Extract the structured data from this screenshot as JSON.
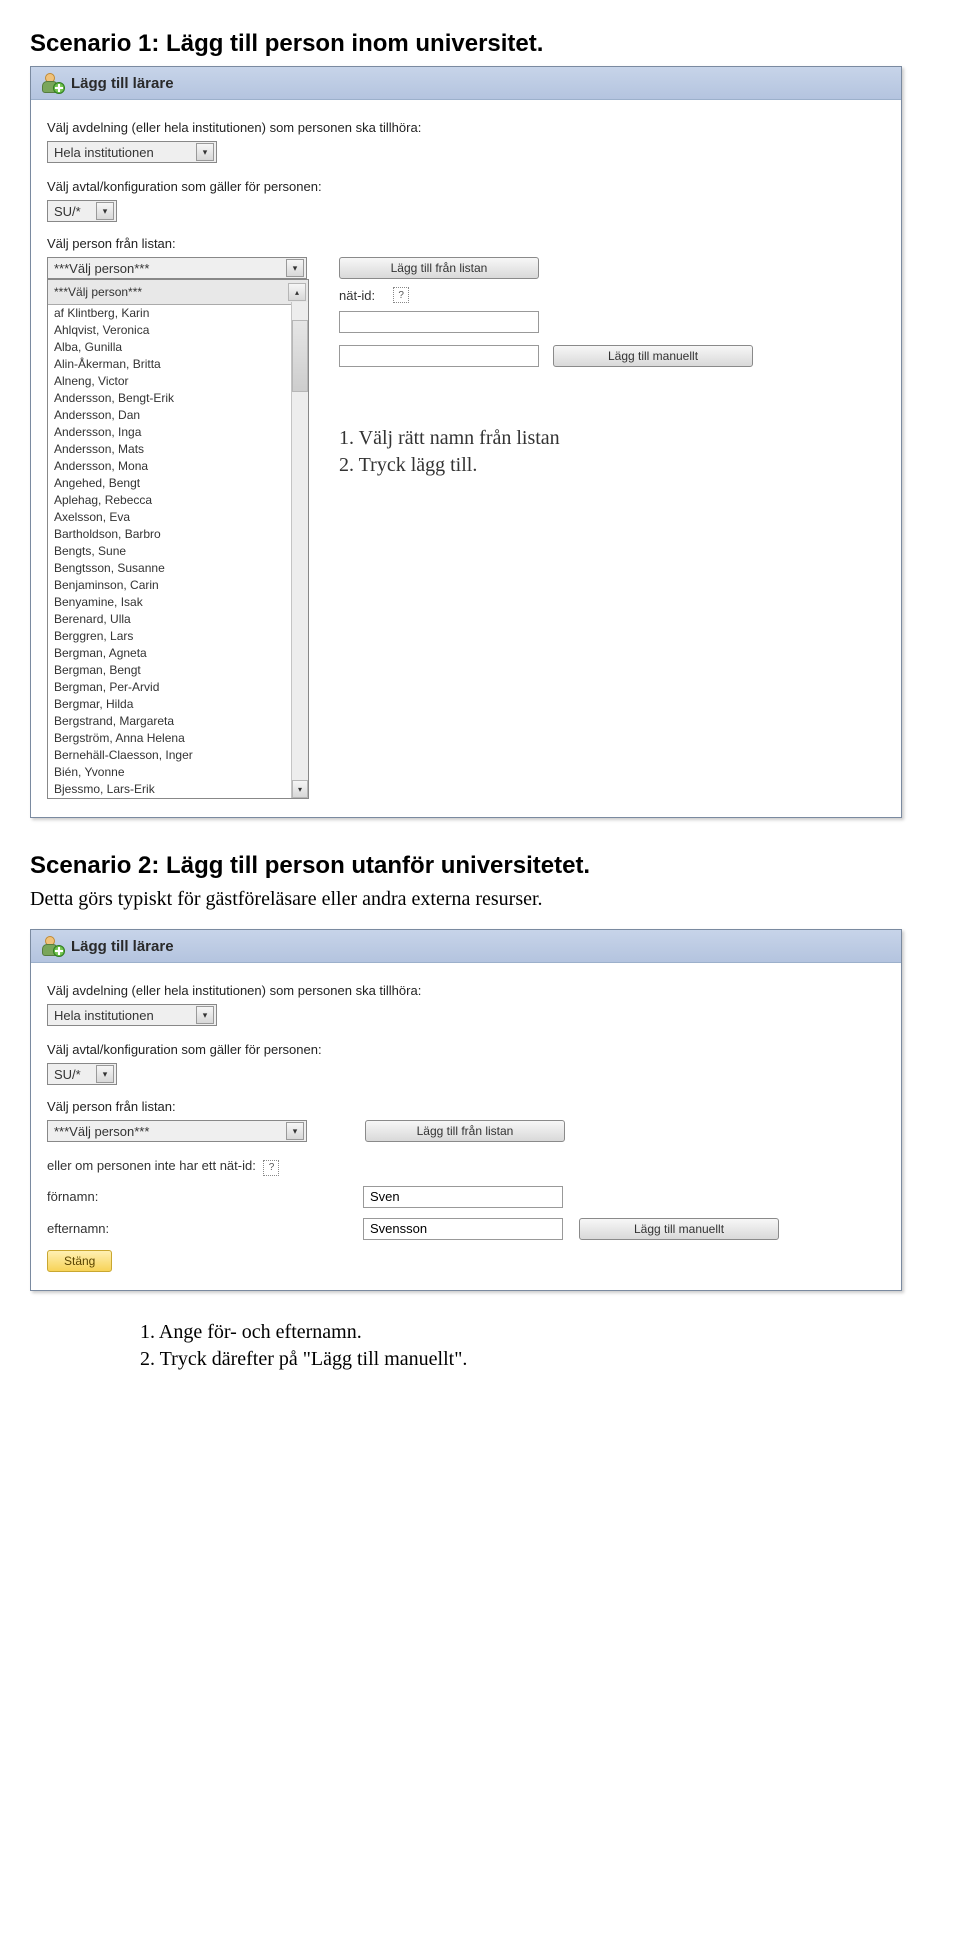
{
  "scenario1": {
    "title": "Scenario 1: Lägg till person inom universitet.",
    "step1": "1. Välj rätt namn från listan",
    "step2": "2. Tryck lägg till."
  },
  "panel1": {
    "header": "Lägg till lärare",
    "label_dept": "Välj avdelning (eller hela institutionen) som personen ska tillhöra:",
    "dept_value": "Hela institutionen",
    "label_avtal": "Välj avtal/konfiguration som gäller för personen:",
    "avtal_value": "SU/*",
    "label_person": "Välj person från listan:",
    "person_value": "***Välj person***",
    "btn_addlist": "Lägg till från listan",
    "natid_label": "nät-id:",
    "btn_manual": "Lägg till manuellt",
    "list_header": "***Välj person***",
    "list": [
      "af Klintberg, Karin",
      "Ahlqvist, Veronica",
      "Alba, Gunilla",
      "Alin-Åkerman, Britta",
      "Alneng, Victor",
      "Andersson, Bengt-Erik",
      "Andersson, Dan",
      "Andersson, Inga",
      "Andersson, Mats",
      "Andersson, Mona",
      "Angehed, Bengt",
      "Aplehag, Rebecca",
      "Axelsson, Eva",
      "Bartholdson, Barbro",
      "Bengts, Sune",
      "Bengtsson, Susanne",
      "Benjaminson, Carin",
      "Benyamine, Isak",
      "Berenard, Ulla",
      "Berggren, Lars",
      "Bergman, Agneta",
      "Bergman, Bengt",
      "Bergman, Per-Arvid",
      "Bergmar, Hilda",
      "Bergstrand, Margareta",
      "Bergström, Anna Helena",
      "Bernehäll-Claesson, Inger",
      "Bién, Yvonne",
      "Bjessmo, Lars-Erik"
    ]
  },
  "scenario2": {
    "title": "Scenario 2: Lägg till person utanför universitetet.",
    "subtitle": "Detta görs typiskt för gästföreläsare eller andra externa resurser.",
    "step1": "1. Ange för- och efternamn.",
    "step2": "2. Tryck därefter på \"Lägg till manuellt\"."
  },
  "panel2": {
    "header": "Lägg till lärare",
    "label_dept": "Välj avdelning (eller hela institutionen) som personen ska tillhöra:",
    "dept_value": "Hela institutionen",
    "label_avtal": "Välj avtal/konfiguration som gäller för personen:",
    "avtal_value": "SU/*",
    "label_person": "Välj person från listan:",
    "person_value": "***Välj person***",
    "btn_addlist": "Lägg till från listan",
    "natid_label": "eller om personen inte har ett nät-id:",
    "fornamn_label": "förnamn:",
    "fornamn_value": "Sven",
    "efternamn_label": "efternamn:",
    "efternamn_value": "Svensson",
    "btn_manual": "Lägg till manuellt",
    "btn_close": "Stäng"
  }
}
